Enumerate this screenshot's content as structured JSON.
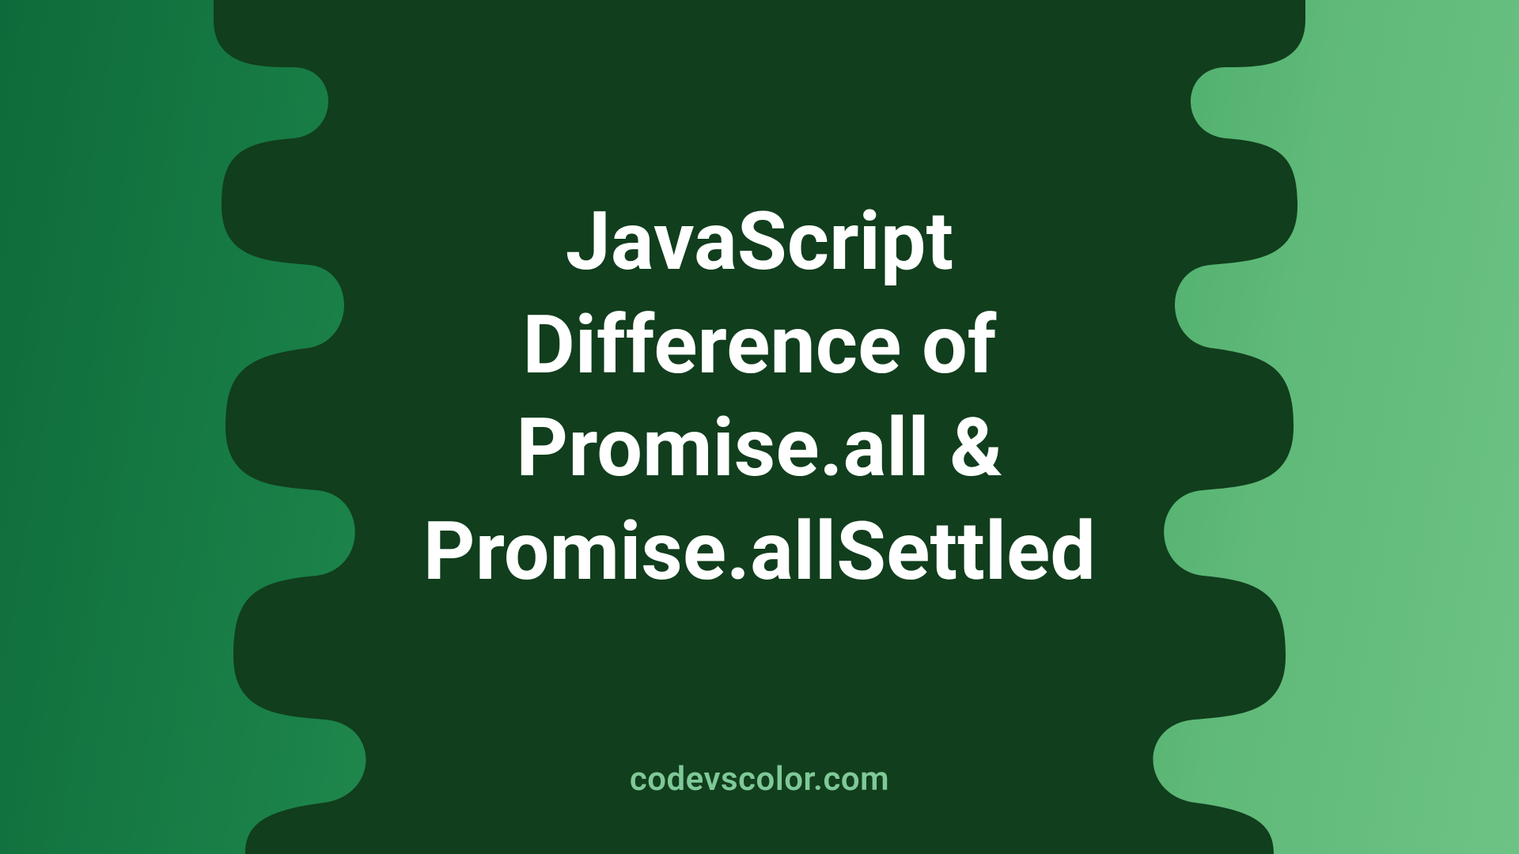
{
  "title_lines": "JavaScript\nDifference of\nPromise.all &\nPromise.allSettled",
  "site": "codevscolor.com"
}
